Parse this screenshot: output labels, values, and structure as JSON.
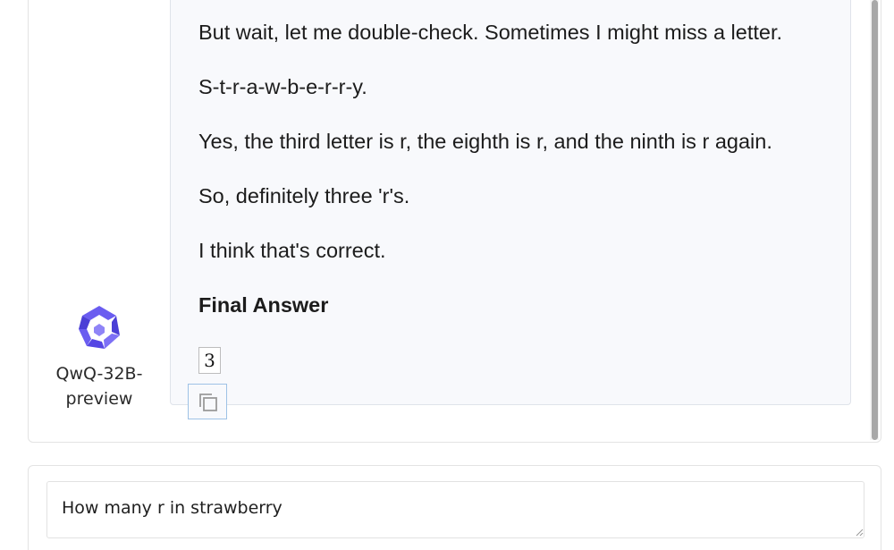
{
  "conversation": {
    "lines": [
      "But wait, let me double-check. Sometimes I might miss a letter.",
      "S-t-r-a-w-b-e-r-r-y.",
      "Yes, the third letter is r, the eighth is r, and the ninth is r again.",
      "So, definitely three 'r's.",
      "I think that's correct."
    ],
    "heading": "Final Answer",
    "boxed_answer": "3"
  },
  "assistant": {
    "name": "QwQ-32B-preview",
    "logo_icon": "qwen-logo-icon",
    "logo_color": "#5b4fe0"
  },
  "actions": {
    "copy_icon": "copy-icon"
  },
  "input": {
    "value": "How many r in strawberry"
  }
}
